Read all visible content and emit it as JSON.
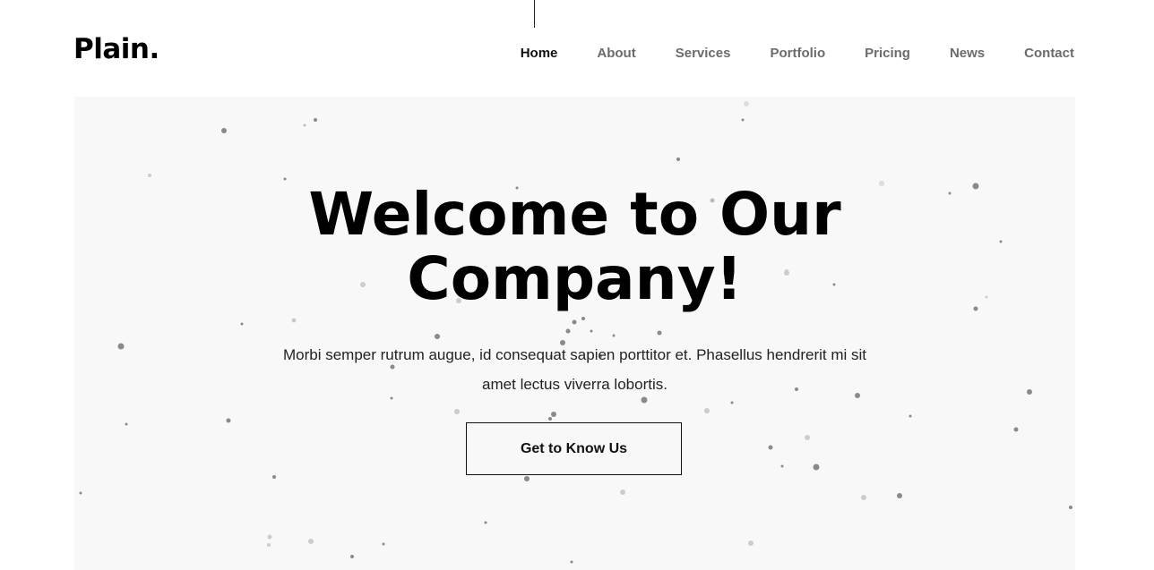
{
  "header": {
    "logo": "Plain.",
    "nav": [
      {
        "label": "Home",
        "active": true
      },
      {
        "label": "About",
        "active": false
      },
      {
        "label": "Services",
        "active": false
      },
      {
        "label": "Portfolio",
        "active": false
      },
      {
        "label": "Pricing",
        "active": false
      },
      {
        "label": "News",
        "active": false
      },
      {
        "label": "Contact",
        "active": false
      }
    ]
  },
  "hero": {
    "title_line1": "Welcome to Our",
    "title_line2": "Company!",
    "subtitle_line1": "Morbi semper rutrum augue, id consequat sapien porttitor et. Phasellus hendrerit mi sit",
    "subtitle_line2": "amet lectus viverra lobortis.",
    "cta_label": "Get to Know Us"
  },
  "colors": {
    "background": "#ffffff",
    "hero_background": "#f8f8f8",
    "text": "#000000",
    "nav_inactive": "#6b6b6b",
    "particle": "#888888"
  }
}
